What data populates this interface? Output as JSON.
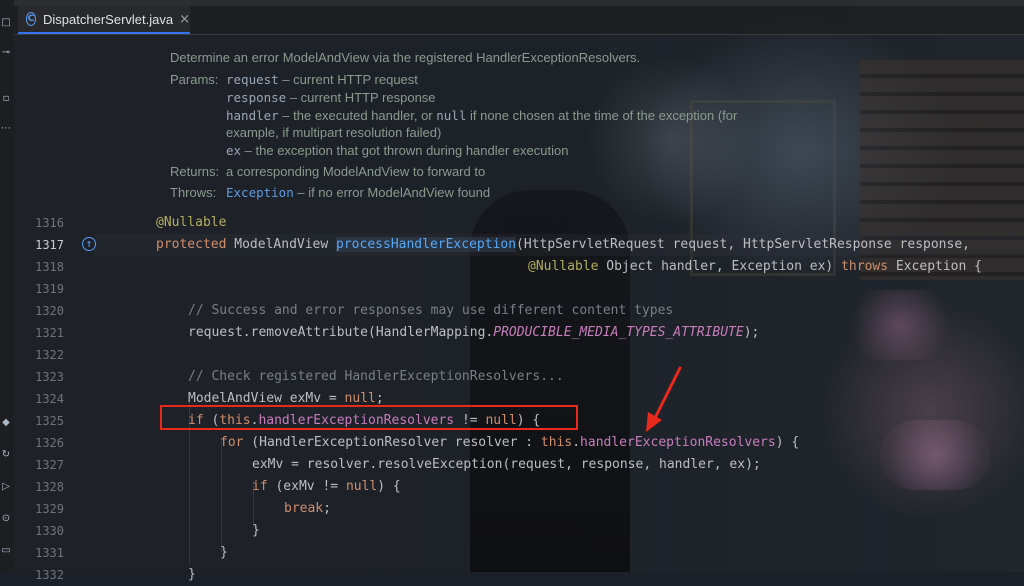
{
  "editor": {
    "tab": {
      "icon": "class-icon",
      "icon_glyph": "C",
      "title": "DispatcherServlet.java",
      "close": "×"
    },
    "toolstrip_icons": [
      "project-icon",
      "commit-icon",
      "structure-icon",
      "more-icon",
      "gradle-icon",
      "run-icon",
      "terminal-icon",
      "problems-icon",
      "services-icon"
    ]
  },
  "docs": {
    "description": "Determine an error ModelAndView via the registered HandlerExceptionResolvers.",
    "params_label": "Params:",
    "params": [
      {
        "name": "request",
        "text": " – current HTTP request"
      },
      {
        "name": "response",
        "text": " – current HTTP response"
      },
      {
        "name": "handler",
        "text": " – the executed handler, or ",
        "code": "null",
        "tail": " if none chosen at the time of the exception (for",
        "cont": "example, if multipart resolution failed)"
      },
      {
        "name": "ex",
        "text": " – the exception that got thrown during handler execution"
      }
    ],
    "returns_label": "Returns:",
    "returns_text": "a corresponding ModelAndView to forward to",
    "throws_label": "Throws:",
    "throws_link": "Exception",
    "throws_text": " – if no error ModelAndView found"
  },
  "line_numbers": [
    "1316",
    "1317",
    "1318",
    "1319",
    "1320",
    "1321",
    "1322",
    "1323",
    "1324",
    "1325",
    "1326",
    "1327",
    "1328",
    "1329",
    "1330",
    "1331",
    "1332"
  ],
  "active_line": "1317",
  "code": {
    "l1316": "@Nullable",
    "l1317_kw": "protected",
    "l1317_type": " ModelAndView ",
    "l1317_fn": "processHandlerException",
    "l1317_rest": "(HttpServletRequest request, HttpServletResponse response,",
    "l1318_ann": "@Nullable",
    "l1318_mid": " Object handler, Exception ex) ",
    "l1318_kw": "throws",
    "l1318_tail": " Exception {",
    "l1320": "// Success and error responses may use different content types",
    "l1321_a": "request.removeAttribute(HandlerMapping.",
    "l1321_const": "PRODUCIBLE_MEDIA_TYPES_ATTRIBUTE",
    "l1321_b": ");",
    "l1323": "// Check registered HandlerExceptionResolvers...",
    "l1324_a": "ModelAndView exMv = ",
    "l1324_kw": "null",
    "l1324_b": ";",
    "l1325_if": "if",
    "l1325_a": " (",
    "l1325_this": "this",
    "l1325_dot": ".",
    "l1325_fld": "handlerExceptionResolvers",
    "l1325_b": " != ",
    "l1325_null": "null",
    "l1325_c": ") {",
    "l1326_for": "for",
    "l1326_a": " (HandlerExceptionResolver resolver : ",
    "l1326_this": "this",
    "l1326_dot": ".",
    "l1326_fld": "handlerExceptionResolvers",
    "l1326_b": ") {",
    "l1327": "exMv = resolver.resolveException(request, response, handler, ex);",
    "l1328_if": "if",
    "l1328_a": " (exMv != ",
    "l1328_null": "null",
    "l1328_b": ") {",
    "l1329_kw": "break",
    "l1329_b": ";",
    "l1330": "}",
    "l1331": "}",
    "l1332": "}"
  },
  "colors": {
    "keyword": "#cf8e6d",
    "annotation": "#b3ae60",
    "function": "#56a8f5",
    "field": "#c77dbb",
    "comment": "#7a7e85",
    "highlight": "#e8291c"
  }
}
